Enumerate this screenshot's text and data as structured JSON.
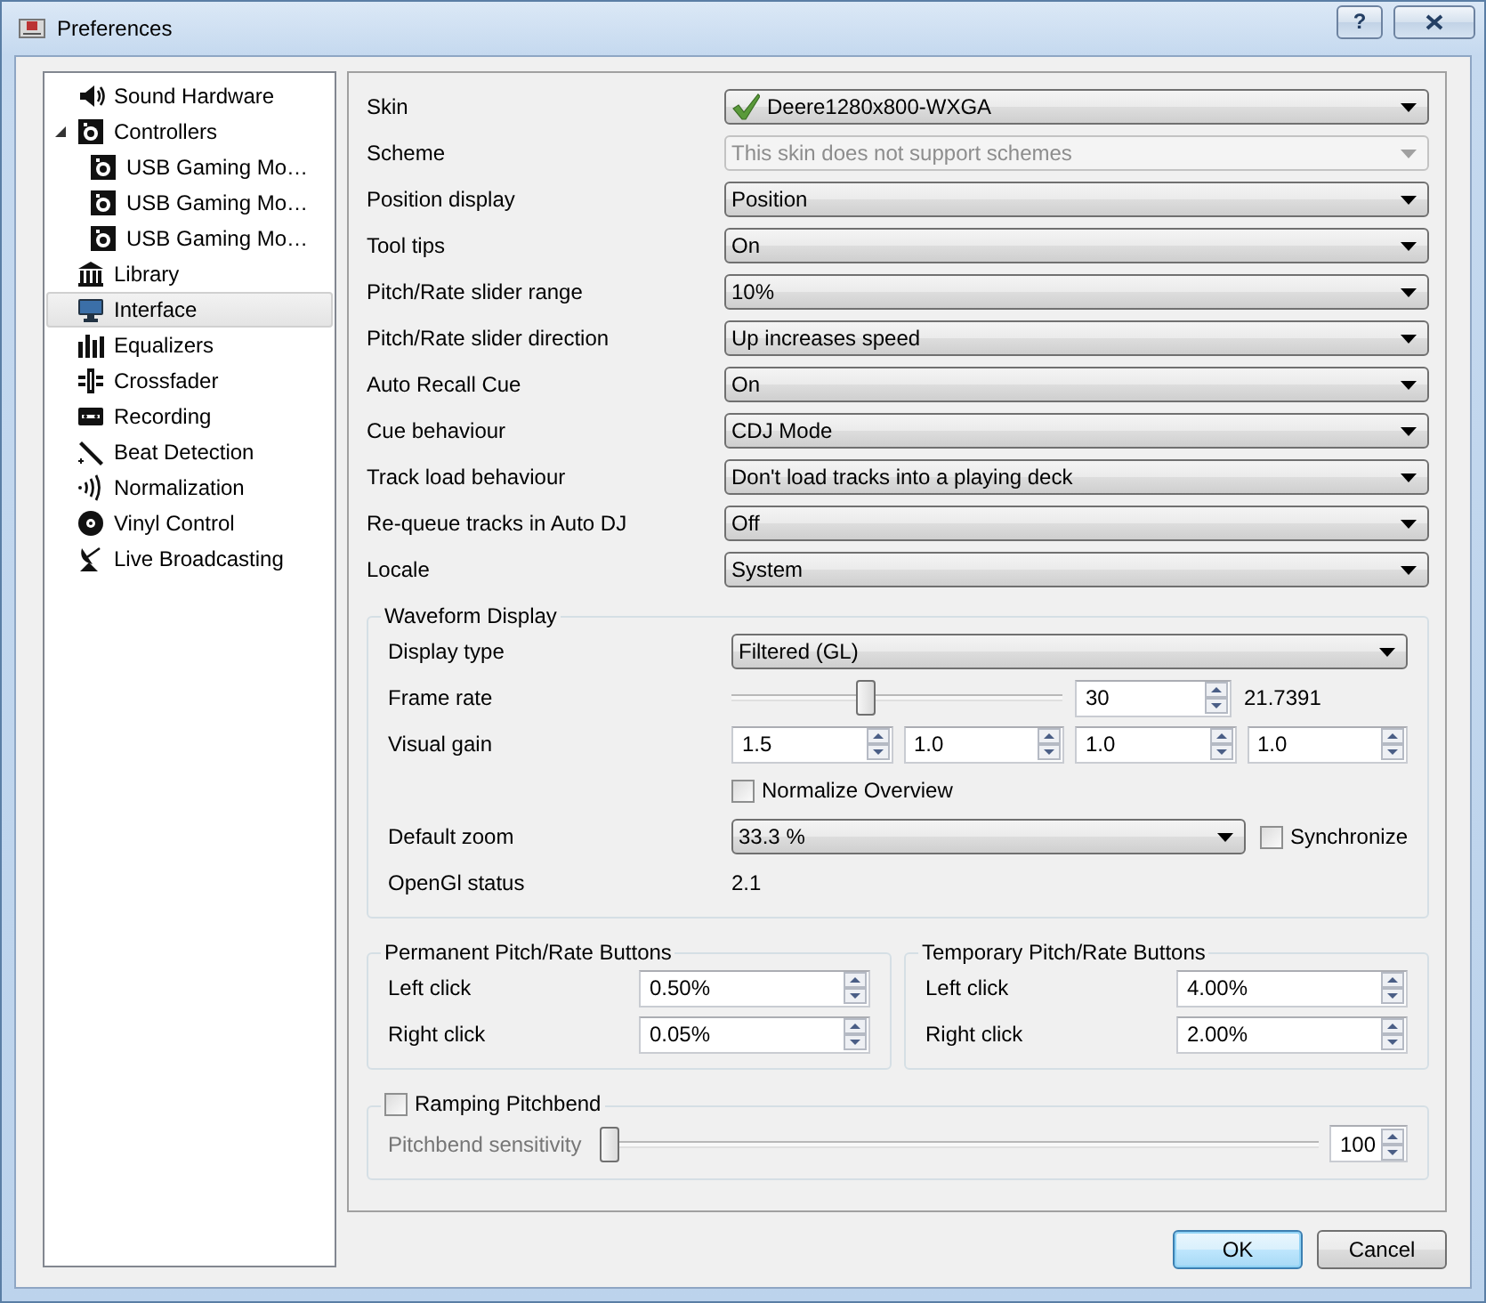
{
  "window": {
    "title": "Preferences",
    "help_button": "?"
  },
  "sidebar": {
    "items": [
      {
        "label": "Sound Hardware",
        "selected": false
      },
      {
        "label": "Controllers",
        "selected": false,
        "expanded": true,
        "children": [
          {
            "label": "USB Gaming Mo…",
            "selected": false
          },
          {
            "label": "USB Gaming Mo…",
            "selected": false
          },
          {
            "label": "USB Gaming Mo…",
            "selected": false
          }
        ]
      },
      {
        "label": "Library",
        "selected": false
      },
      {
        "label": "Interface",
        "selected": true
      },
      {
        "label": "Equalizers",
        "selected": false
      },
      {
        "label": "Crossfader",
        "selected": false
      },
      {
        "label": "Recording",
        "selected": false
      },
      {
        "label": "Beat Detection",
        "selected": false
      },
      {
        "label": "Normalization",
        "selected": false
      },
      {
        "label": "Vinyl Control",
        "selected": false
      },
      {
        "label": "Live Broadcasting",
        "selected": false
      }
    ]
  },
  "settings": [
    {
      "label": "Skin",
      "value": "Deere1280x800-WXGA",
      "disabled": false
    },
    {
      "label": "Scheme",
      "value": "This skin does not support schemes",
      "disabled": true
    },
    {
      "label": "Position display",
      "value": "Position",
      "disabled": false
    },
    {
      "label": "Tool tips",
      "value": "On",
      "disabled": false
    },
    {
      "label": "Pitch/Rate slider range",
      "value": "10%",
      "disabled": false
    },
    {
      "label": "Pitch/Rate slider direction",
      "value": "Up increases speed",
      "disabled": false
    },
    {
      "label": "Auto Recall Cue",
      "value": "On",
      "disabled": false
    },
    {
      "label": "Cue behaviour",
      "value": "CDJ Mode",
      "disabled": false
    },
    {
      "label": "Track load behaviour",
      "value": "Don't load tracks into a playing deck",
      "disabled": false
    },
    {
      "label": "Re-queue tracks in Auto DJ",
      "value": "Off",
      "disabled": false
    },
    {
      "label": "Locale",
      "value": "System",
      "disabled": false
    }
  ],
  "waveform": {
    "title": "Waveform Display",
    "display_type": {
      "label": "Display type",
      "value": "Filtered (GL)"
    },
    "frame_rate": {
      "label": "Frame rate",
      "level": 0.4,
      "value": "30",
      "reading": "21.7391"
    },
    "visual_gain": {
      "label": "Visual gain",
      "values": [
        "1.5",
        "1.0",
        "1.0",
        "1.0"
      ]
    },
    "normalize_overview": {
      "label": "Normalize Overview",
      "checked": false
    },
    "default_zoom": {
      "label": "Default zoom",
      "value": "33.3 %"
    },
    "synchronize": {
      "label": "Synchronize",
      "checked": false
    },
    "opengl_status": {
      "label": "OpenGl status",
      "value": "2.1"
    }
  },
  "pitch_groups": [
    {
      "title": "Permanent Pitch/Rate Buttons",
      "rows": [
        {
          "label": "Left click",
          "value": "0.50%"
        },
        {
          "label": "Right click",
          "value": "0.05%"
        }
      ]
    },
    {
      "title": "Temporary Pitch/Rate Buttons",
      "rows": [
        {
          "label": "Left click",
          "value": "4.00%"
        },
        {
          "label": "Right click",
          "value": "2.00%"
        }
      ]
    }
  ],
  "ramping_pitchbend": {
    "label": "Ramping Pitchbend",
    "checked": false,
    "sensitivity_label": "Pitchbend sensitivity",
    "level": 0,
    "value": "100",
    "disabled": true
  },
  "buttons": [
    {
      "label": "OK",
      "default": true
    },
    {
      "label": "Cancel",
      "default": false
    }
  ]
}
